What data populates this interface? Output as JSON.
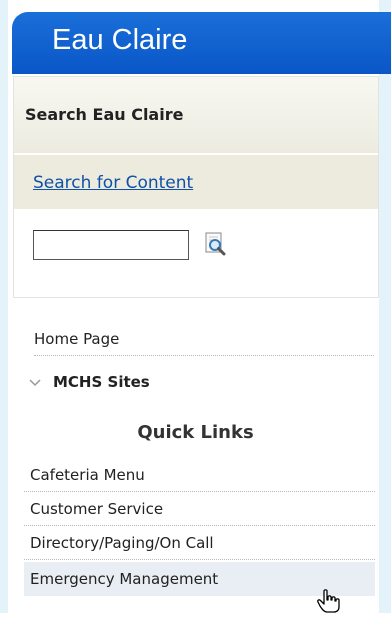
{
  "header": {
    "title": "Eau Claire"
  },
  "search": {
    "heading": "Search Eau Claire",
    "link_label": "Search for Content",
    "input_value": ""
  },
  "nav": {
    "home": "Home Page",
    "sites": "MCHS Sites"
  },
  "quick_links": {
    "heading": "Quick Links",
    "items": [
      "Cafeteria Menu",
      "Customer Service",
      "Directory/Paging/On Call",
      "Emergency Management"
    ]
  },
  "icons": {
    "search": "search-icon",
    "chevron": "chevron-down-icon",
    "cursor": "hand-pointer-icon"
  },
  "colors": {
    "header_blue": "#0a56c8",
    "link_blue": "#1050a8",
    "frame_blue": "#e4f3fa",
    "hover_bg": "#e8eef3"
  }
}
